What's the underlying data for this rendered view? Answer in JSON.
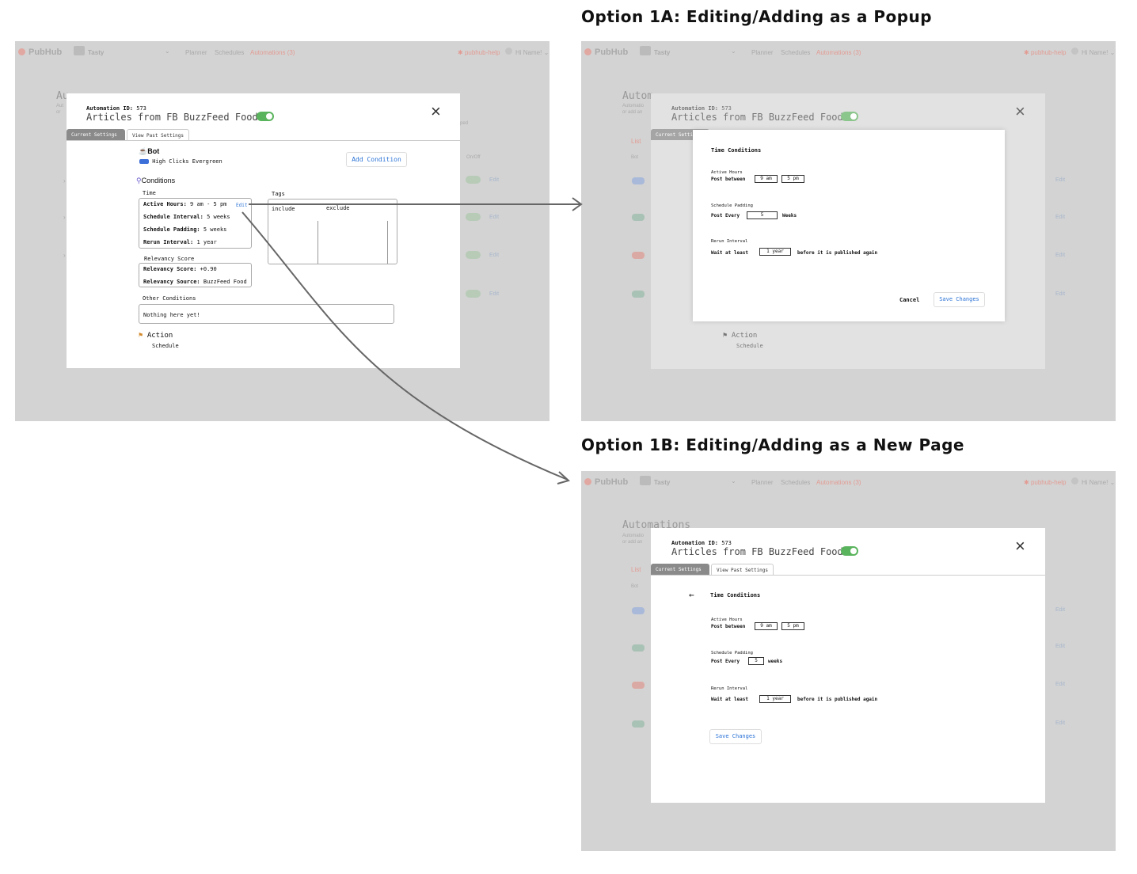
{
  "headings": {
    "option_1a": "Option 1A: Editing/Adding as a Popup",
    "option_1b": "Option 1B: Editing/Adding as a New Page"
  },
  "app": {
    "logo": "PubHub",
    "brand": "Tasty",
    "nav": [
      "Planner",
      "Schedules",
      "Automations (3)"
    ],
    "help": "pubhub-help",
    "user": "Hi Name!",
    "page_title": "Automations",
    "page_title_short": "Autom",
    "subtitle_line1": "Automatio",
    "subtitle_line2": "or add an",
    "list_label": "List",
    "col_bot": "Bot",
    "col_onoff": "On/Off",
    "row_edit": "Edit",
    "sub_trailing": "ped"
  },
  "modal": {
    "id_label": "Automation ID:",
    "id_value": "573",
    "title": "Articles from FB BuzzFeed Food",
    "close_icon": "×",
    "tabs": [
      "Current Settings",
      "View Past Settings"
    ],
    "bot_heading": "Bot",
    "bot_name": "High Clicks Evergreen",
    "add_condition": "Add Condition",
    "conditions_heading": "Conditions",
    "time_label": "Time",
    "time_rows": [
      {
        "label": "Active Hours:",
        "value": "9 am - 5 pm"
      },
      {
        "label": "Schedule Interval:",
        "value": "5 weeks"
      },
      {
        "label": "Schedule Padding:",
        "value": "5 weeks"
      },
      {
        "label": "Rerun Interval:",
        "value": "1 year"
      }
    ],
    "edit_link": "Edit",
    "tags_label": "Tags",
    "tags_include": "include",
    "tags_exclude": "exclude",
    "relevancy_label": "Relevancy Score",
    "relevancy_rows": [
      {
        "label": "Relevancy Score:",
        "value": "+0.90"
      },
      {
        "label": "Relevancy Source:",
        "value": "BuzzFeed Food"
      }
    ],
    "other_label": "Other Conditions",
    "other_value": "Nothing here yet!",
    "action_heading": "Action",
    "action_value": "Schedule"
  },
  "time_conditions": {
    "title": "Time Conditions",
    "active_hours_label": "Active Hours",
    "post_between": "Post between",
    "from_value": "9 am",
    "to_value": "5 pm",
    "padding_label": "Schedule Padding",
    "post_every": "Post Every",
    "padding_value": "5",
    "weeks_cap": "Weeks",
    "weeks_lower": "weeks",
    "rerun_label": "Rerun Interval",
    "wait_at_least": "Wait at least",
    "rerun_value": "1 year",
    "after_text": "before it is published again",
    "cancel": "Cancel",
    "save": "Save Changes"
  },
  "colors": {
    "frame_bg": "#d3d3d3",
    "toggle_on": "#5ab45d",
    "link_blue": "#2b73d6",
    "accent_red": "#e29b93",
    "arrow": "#666666"
  }
}
